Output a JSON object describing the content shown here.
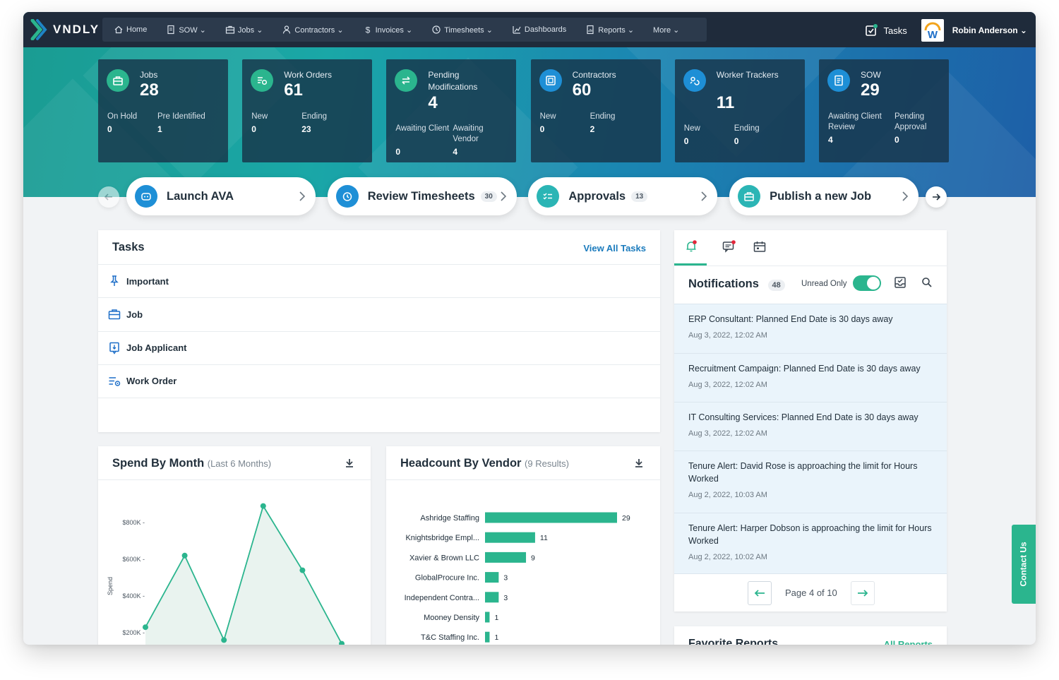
{
  "app": {
    "logo": "VNDLY"
  },
  "nav": {
    "items": [
      {
        "label": "Home",
        "icon": "home-icon"
      },
      {
        "label": "SOW ⌄",
        "icon": "document-icon"
      },
      {
        "label": "Jobs ⌄",
        "icon": "briefcase-icon"
      },
      {
        "label": "Contractors ⌄",
        "icon": "person-icon"
      },
      {
        "label": "Invoices ⌄",
        "icon": "dollar-icon"
      },
      {
        "label": "Timesheets ⌄",
        "icon": "clock-icon"
      },
      {
        "label": "Dashboards",
        "icon": "chart-icon"
      },
      {
        "label": "Reports ⌄",
        "icon": "report-icon"
      },
      {
        "label": "More ⌄",
        "icon": "none"
      }
    ],
    "tasks_label": "Tasks",
    "user_name": "Robin Anderson ⌄"
  },
  "stats": [
    {
      "name": "Jobs",
      "value": "28",
      "color": "#2bb58e",
      "subs": [
        {
          "label": "On Hold",
          "value": "0"
        },
        {
          "label": "Pre Identified",
          "value": "1"
        }
      ]
    },
    {
      "name": "Work Orders",
      "value": "61",
      "color": "#2bb58e",
      "subs": [
        {
          "label": "New",
          "value": "0"
        },
        {
          "label": "Ending",
          "value": "23"
        }
      ]
    },
    {
      "name": "Pending Modifications",
      "value": "4",
      "color": "#2bb58e",
      "subs": [
        {
          "label": "Awaiting Client",
          "value": "0"
        },
        {
          "label": "Awaiting Vendor",
          "value": "4"
        }
      ]
    },
    {
      "name": "Contractors",
      "value": "60",
      "color": "#1e8fd6",
      "subs": [
        {
          "label": "New",
          "value": "0"
        },
        {
          "label": "Ending",
          "value": "2"
        }
      ]
    },
    {
      "name": "Worker Trackers",
      "value": "11",
      "color": "#1e8fd6",
      "subs": [
        {
          "label": "New",
          "value": "0"
        },
        {
          "label": "Ending",
          "value": "0"
        }
      ]
    },
    {
      "name": "SOW",
      "value": "29",
      "color": "#1e8fd6",
      "subs": [
        {
          "label": "Awaiting Client Review",
          "value": "4"
        },
        {
          "label": "Pending Approval",
          "value": "0"
        }
      ]
    }
  ],
  "actions": [
    {
      "label": "Launch AVA",
      "badge": "",
      "color": "#1e8fd6"
    },
    {
      "label": "Review Timesheets",
      "badge": "30",
      "color": "#1e8fd6"
    },
    {
      "label": "Approvals",
      "badge": "13",
      "color": "#2bb5b5"
    },
    {
      "label": "Publish a new Job",
      "badge": "",
      "color": "#2bb5b5"
    }
  ],
  "tasks": {
    "title": "Tasks",
    "view_all": "View All Tasks",
    "items": [
      {
        "label": "Important",
        "icon": "pin-icon"
      },
      {
        "label": "Job",
        "icon": "briefcase-icon"
      },
      {
        "label": "Job Applicant",
        "icon": "applicant-icon"
      },
      {
        "label": "Work Order",
        "icon": "work-order-icon"
      }
    ]
  },
  "notifications": {
    "title": "Notifications",
    "count": "48",
    "unread_label": "Unread Only",
    "items": [
      {
        "text": "ERP Consultant: Planned End Date is 30 days away",
        "date": "Aug 3, 2022, 12:02 AM"
      },
      {
        "text": "Recruitment Campaign: Planned End Date is 30 days away",
        "date": "Aug 3, 2022, 12:02 AM"
      },
      {
        "text": "IT Consulting Services: Planned End Date is 30 days away",
        "date": "Aug 3, 2022, 12:02 AM"
      },
      {
        "text": "Tenure Alert: David Rose is approaching the limit for Hours Worked",
        "date": "Aug 2, 2022, 10:03 AM"
      },
      {
        "text": "Tenure Alert: Harper Dobson is approaching the limit for Hours Worked",
        "date": "Aug 2, 2022, 10:02 AM"
      }
    ],
    "page_label": "Page 4 of 10"
  },
  "favorite_reports": {
    "title": "Favorite Reports",
    "link": "All Reports"
  },
  "contact_us": "Contact Us",
  "spend_chart": {
    "title": "Spend By Month",
    "subtitle": "(Last 6 Months)",
    "ylabel": "Spend",
    "ticks": [
      "$200K -",
      "$400K -",
      "$600K -",
      "$800K -"
    ]
  },
  "headcount_chart": {
    "title": "Headcount By Vendor",
    "subtitle": "(9 Results)"
  },
  "chart_data": [
    {
      "type": "area",
      "title": "Spend By Month",
      "subtitle": "(Last 6 Months)",
      "ylabel": "Spend",
      "y_ticks": [
        200000,
        400000,
        600000,
        800000
      ],
      "values": [
        230000,
        620000,
        160000,
        890000,
        540000,
        140000
      ],
      "color": "#2bb58e"
    },
    {
      "type": "bar",
      "orientation": "horizontal",
      "title": "Headcount By Vendor",
      "subtitle": "(9 Results)",
      "categories": [
        "Ashridge Staffing",
        "Knightsbridge Empl...",
        "Xavier & Brown LLC",
        "GlobalProcure Inc.",
        "Independent Contra...",
        "Mooney Density",
        "T&C Staffing Inc."
      ],
      "values": [
        29,
        11,
        9,
        3,
        3,
        1,
        1
      ],
      "xlim": [
        0,
        29
      ],
      "color": "#2bb58e"
    }
  ]
}
